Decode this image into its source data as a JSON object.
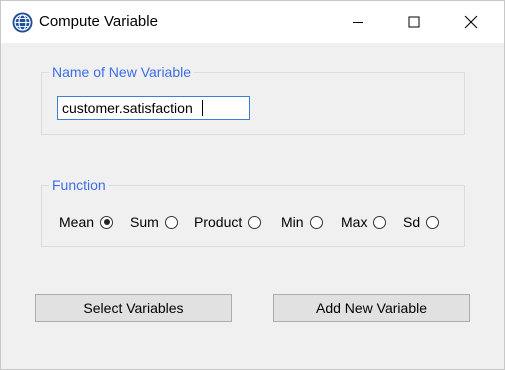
{
  "window": {
    "title": "Compute Variable",
    "app_icon": "globe-icon",
    "controls": [
      "minimize-icon",
      "maximize-icon",
      "close-icon"
    ]
  },
  "name_group": {
    "legend": "Name of New Variable",
    "input_value": "customer.satisfaction"
  },
  "function_group": {
    "legend": "Function",
    "options": [
      "Mean",
      "Sum",
      "Product",
      "Min",
      "Max",
      "Sd"
    ],
    "selected": "Mean"
  },
  "buttons": {
    "select_variables": "Select Variables",
    "add_new_variable": "Add New Variable"
  },
  "colors": {
    "legend_text": "#3c6ee6",
    "input_border": "#3c7fd6",
    "window_bg": "#f0f0f0",
    "button_bg": "#e1e1e1"
  }
}
